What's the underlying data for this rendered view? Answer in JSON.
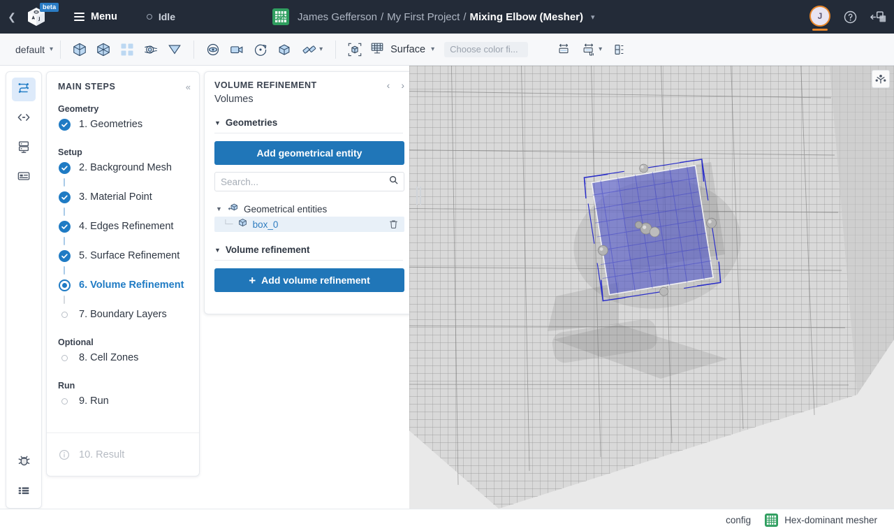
{
  "header": {
    "back_icon": "chevron-left-icon",
    "logo_icon": "cube-logo-icon",
    "beta_badge": "beta",
    "menu_label": "Menu",
    "status_label": "Idle",
    "project_icon": "mesh-grid-icon",
    "breadcrumb": {
      "owner": "James Gefferson",
      "sep1": "/",
      "project": "My First Project",
      "sep2": "/",
      "current": "Mixing Elbow (Mesher)",
      "caret_icon": "chevron-down-icon"
    },
    "avatar_initial": "J",
    "help_icon": "help-circle-icon",
    "panel_icon": "toggle-panel-icon"
  },
  "toolbar": {
    "preset_label": "default",
    "preset_caret_icon": "chevron-down-icon",
    "groups": [
      {
        "items": [
          {
            "name": "show-geometry-icon"
          },
          {
            "name": "show-mesh-icon"
          },
          {
            "name": "grid-view-icon"
          },
          {
            "name": "contours-icon"
          },
          {
            "name": "filter-icon"
          }
        ]
      },
      {
        "items": [
          {
            "name": "view-eye-icon"
          },
          {
            "name": "camera-icon"
          },
          {
            "name": "rotate-icon"
          },
          {
            "name": "cube-icon"
          },
          {
            "name": "clip-planes-icon",
            "caret": true
          }
        ]
      }
    ],
    "fit_icon": "fit-to-view-icon",
    "display_mode_icon": "surface-mesh-icon",
    "display_mode_label": "Surface",
    "display_mode_caret_icon": "chevron-down-icon",
    "color_field_placeholder": "Choose color fi...",
    "range_icon": "color-range-icon",
    "scale-bar_icon": "scale-range-icon",
    "legend_icon": "legend-icon"
  },
  "rail": {
    "items": [
      {
        "name": "workflow-icon",
        "active": true
      },
      {
        "name": "code-icon",
        "active": false
      },
      {
        "name": "server-icon",
        "active": false
      },
      {
        "name": "console-panel-icon",
        "active": false
      }
    ],
    "bottom_items": [
      {
        "name": "bug-icon"
      },
      {
        "name": "table-list-icon"
      }
    ]
  },
  "steps": {
    "title": "MAIN STEPS",
    "collapse_icon": "collapse-left-icon",
    "groups": [
      {
        "label": "Geometry",
        "items": [
          {
            "label": "1. Geometries",
            "state": "done",
            "connector": false
          }
        ]
      },
      {
        "label": "Setup",
        "items": [
          {
            "label": "2. Background Mesh",
            "state": "done",
            "connector": true
          },
          {
            "label": "3. Material Point",
            "state": "done",
            "connector": true
          },
          {
            "label": "4. Edges Refinement",
            "state": "done",
            "connector": true
          },
          {
            "label": "5. Surface Refinement",
            "state": "done",
            "connector": true
          },
          {
            "label": "6. Volume Refinement",
            "state": "current",
            "connector": true
          },
          {
            "label": "7. Boundary Layers",
            "state": "todo",
            "connector": false
          }
        ]
      },
      {
        "label": "Optional",
        "items": [
          {
            "label": "8. Cell Zones",
            "state": "todo",
            "connector": false
          }
        ]
      },
      {
        "label": "Run",
        "items": [
          {
            "label": "9. Run",
            "state": "todo",
            "connector": false
          }
        ]
      }
    ],
    "footer": {
      "label": "10. Result",
      "icon": "info-circle-icon"
    }
  },
  "panel": {
    "title": "VOLUME REFINEMENT",
    "subtitle": "Volumes",
    "prev_icon": "chevron-left-icon",
    "next_icon": "chevron-right-icon",
    "section_geometries": {
      "toggle_icon": "triangle-down-icon",
      "label": "Geometries",
      "add_button": "Add geometrical entity",
      "search_placeholder": "Search...",
      "search_value": "",
      "search_icon": "search-icon",
      "tree_root": {
        "twisty_icon": "chevron-down-icon",
        "icon": "entities-icon",
        "label": "Geometrical entities"
      },
      "tree_children": [
        {
          "icon": "box-icon",
          "label": "box_0",
          "delete_icon": "trash-icon",
          "selected": true
        }
      ]
    },
    "section_volume": {
      "toggle_icon": "triangle-down-icon",
      "label": "Volume refinement",
      "add_button": "Add volume refinement",
      "add_button_icon": "plus-icon"
    }
  },
  "viewport": {
    "gizmo_icon": "axes-gizmo-icon",
    "splitter_icon": "drag-handle-icon"
  },
  "statusbar": {
    "config_label": "config",
    "mesher_icon": "mesh-grid-icon",
    "mesher_label": "Hex-dominant mesher"
  },
  "colors": {
    "header_bg": "#232b38",
    "accent_blue": "#2076b8",
    "active_blue": "#1f7bc4",
    "avatar_orange": "#e8862a",
    "mesher_green": "#2f9e5f",
    "selection_blue": "#3b3fc4"
  }
}
